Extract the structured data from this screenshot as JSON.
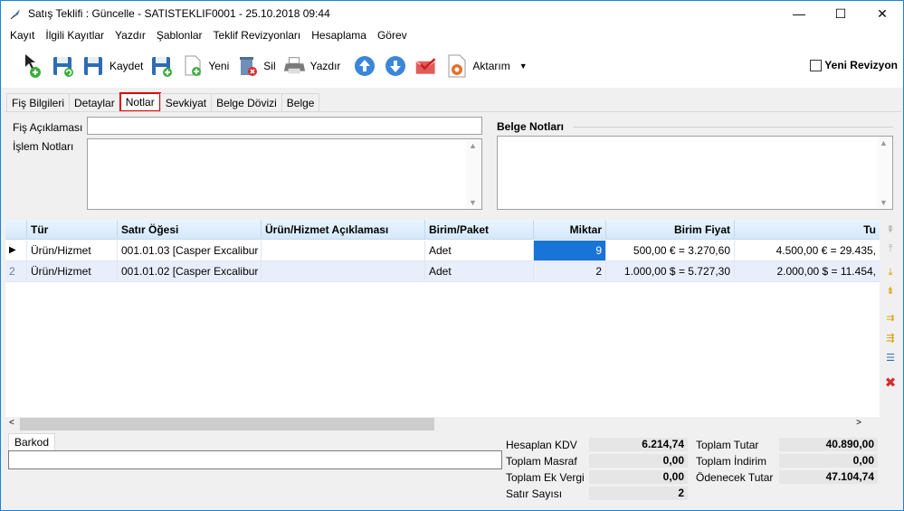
{
  "window": {
    "title": "Satış Teklifi : Güncelle - SATISTEKLIF0001 - 25.10.2018 09:44",
    "minimize": "—",
    "maximize": "☐",
    "close": "✕"
  },
  "menu": [
    "Kayıt",
    "İlgili Kayıtlar",
    "Yazdır",
    "Şablonlar",
    "Teklif Revizyonları",
    "Hesaplama",
    "Görev"
  ],
  "toolbar": {
    "kaydet_label": "Kaydet",
    "yeni_label": "Yeni",
    "sil_label": "Sil",
    "yazdir_label": "Yazdır",
    "aktarim_label": "Aktarım",
    "yeni_revizyon_label": "Yeni Revizyon",
    "yeni_revizyon_checked": false
  },
  "tabs": [
    "Fiş Bilgileri",
    "Detaylar",
    "Notlar",
    "Sevkiyat",
    "Belge Dövizi",
    "Belge"
  ],
  "active_tab": "Notlar",
  "notes": {
    "fis_aciklamasi_label": "Fiş Açıklaması",
    "fis_aciklamasi_value": "",
    "islem_notlari_label": "İşlem Notları",
    "islem_notlari_value": "",
    "belge_notlari_label": "Belge Notları",
    "belge_notlari_value": ""
  },
  "grid": {
    "columns": [
      "Tür",
      "Satır Öğesi",
      "Ürün/Hizmet Açıklaması",
      "Birim/Paket",
      "Miktar",
      "Birim Fiyat",
      "Tu"
    ],
    "rows": [
      {
        "indicator": "▶",
        "tur": "Ürün/Hizmet",
        "satir": "001.01.03 [Casper Excalibur ...",
        "aciklama": "",
        "birim": "Adet",
        "miktar": "9",
        "fiyat": "500,00 € = 3.270,60",
        "tutar": "4.500,00 € = 29.435,"
      },
      {
        "indicator": "2",
        "tur": "Ürün/Hizmet",
        "satir": "001.01.02 [Casper Excalibur ...",
        "aciklama": "",
        "birim": "Adet",
        "miktar": "2",
        "fiyat": "1.000,00 $ = 5.727,30",
        "tutar": "2.000,00 $ = 11.454,"
      }
    ]
  },
  "barkod": {
    "tab_label": "Barkod",
    "value": ""
  },
  "summary": {
    "hesaplan_kdv_label": "Hesaplan KDV",
    "hesaplan_kdv": "6.214,74",
    "toplam_masraf_label": "Toplam Masraf",
    "toplam_masraf": "0,00",
    "toplam_ek_vergi_label": "Toplam Ek Vergi",
    "toplam_ek_vergi": "0,00",
    "satir_sayisi_label": "Satır Sayısı",
    "satir_sayisi": "2",
    "toplam_tutar_label": "Toplam Tutar",
    "toplam_tutar": "40.890,00",
    "toplam_indirim_label": "Toplam İndirim",
    "toplam_indirim": "0,00",
    "odenecek_tutar_label": "Ödenecek Tutar",
    "odenecek_tutar": "47.104,74"
  },
  "colors": {
    "selection": "#1874d7",
    "active_tab_border": "#e00000",
    "header_gradient": "#d4e8fb"
  }
}
